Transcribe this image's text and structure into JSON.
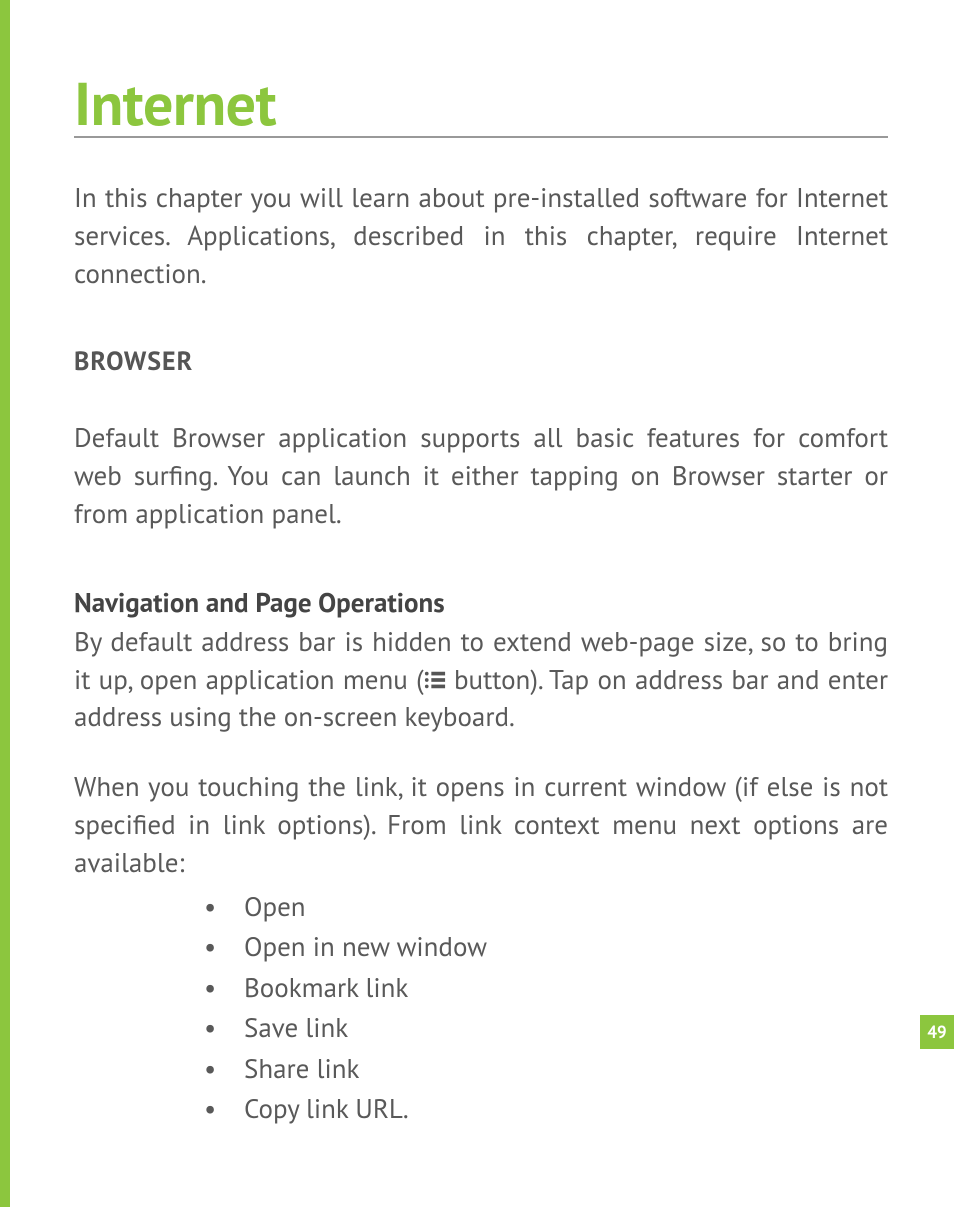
{
  "chapter_title": "Internet",
  "intro": "In this chapter you will learn about pre-installed software for Internet services. Applications, described in this chapter, require Internet connection.",
  "section_heading": "BROWSER",
  "browser_body": "Default Browser application supports all basic features for comfort web surfing. You can launch it either tapping on Browser starter or from application panel.",
  "subsection_heading": "Navigation and Page Operations",
  "nav_body_pre": "By default address bar is hidden to extend web-page size, so to bring it up, open application menu (",
  "nav_body_post": " button). Tap on address bar and enter address using the on-screen keyboard.",
  "link_body": "When you touching the link, it opens in current window (if else is not specified in link options). From link context menu next options are available:",
  "options": [
    "Open",
    "Open in new window",
    "Bookmark link",
    "Save link",
    "Share link",
    "Copy link URL."
  ],
  "page_number": "49"
}
